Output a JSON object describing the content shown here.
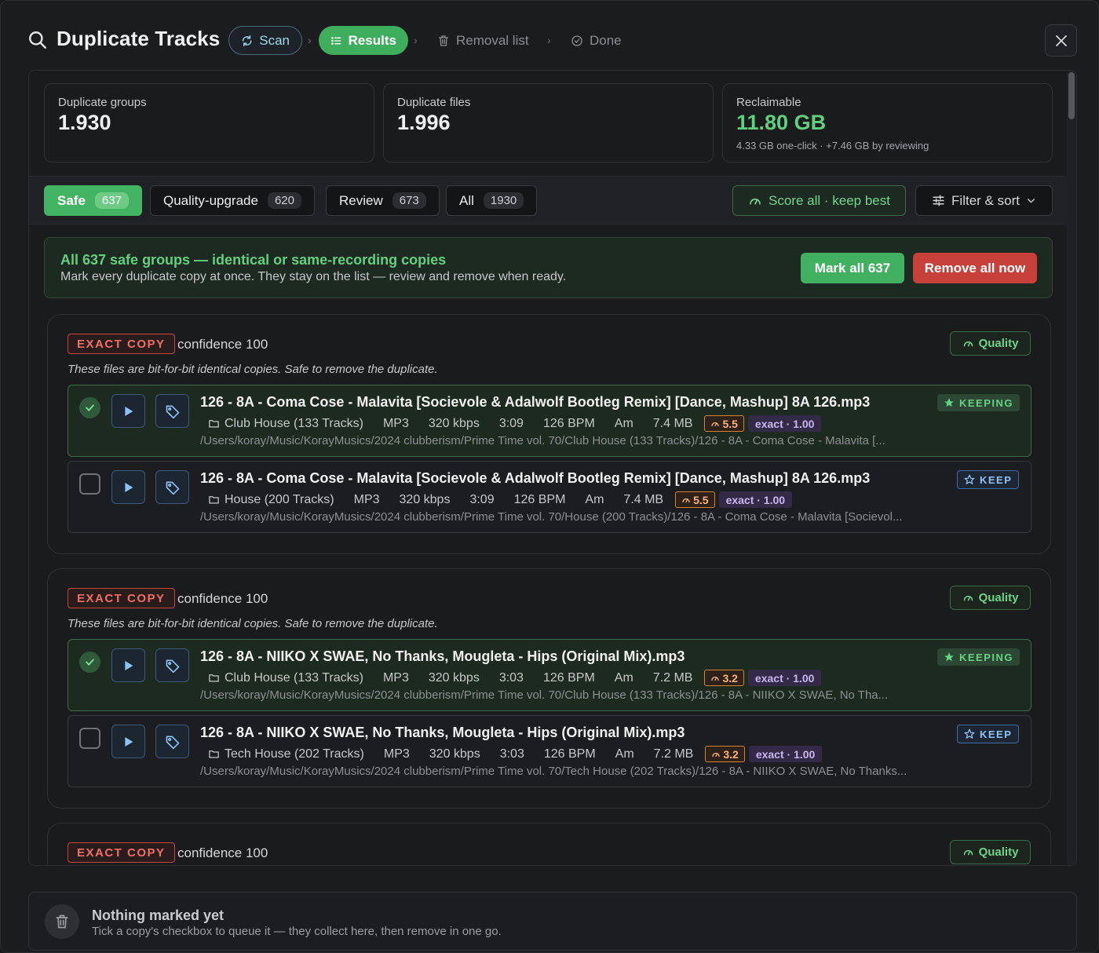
{
  "header": {
    "title": "Duplicate Tracks",
    "steps": {
      "scan": "Scan",
      "results": "Results",
      "removal": "Removal list",
      "done": "Done"
    }
  },
  "stats": {
    "groups": {
      "label": "Duplicate groups",
      "value": "1.930"
    },
    "files": {
      "label": "Duplicate files",
      "value": "1.996"
    },
    "reclaimable": {
      "label": "Reclaimable",
      "value": "11.80 GB",
      "sub": "4.33 GB one-click · +7.46 GB by reviewing"
    }
  },
  "tabs": [
    {
      "label": "Safe",
      "count": "637"
    },
    {
      "label": "Quality-upgrade",
      "count": "620"
    },
    {
      "label": "Review",
      "count": "673"
    },
    {
      "label": "All",
      "count": "1930"
    }
  ],
  "actions": {
    "score_all": "Score all · keep best",
    "filter_sort": "Filter & sort"
  },
  "banner": {
    "title": "All 637 safe groups — identical or same-recording copies",
    "subtitle": "Mark every duplicate copy at once. They stay on the list — review and remove when ready.",
    "mark_all": "Mark all 637",
    "remove_all": "Remove all now"
  },
  "groups": [
    {
      "badge": "EXACT COPY",
      "confidence": "confidence 100",
      "quality_label": "Quality",
      "description": "These files are bit-for-bit identical copies. Safe to remove the duplicate.",
      "tracks": [
        {
          "name": "126 - 8A - Coma Cose - Malavita [Socievole & Adalwolf Bootleg Remix] [Dance, Mashup] 8A 126.mp3",
          "folder": "Club House (133 Tracks)",
          "format": "MP3",
          "bitrate": "320 kbps",
          "duration": "3:09",
          "bpm": "126 BPM",
          "key": "Am",
          "size": "7.4 MB",
          "score": "5.5",
          "match": "exact · 1.00",
          "path": "/Users/koray/Music/KorayMusics/2024 clubberism/Prime Time vol. 70/Club House (133 Tracks)/126 - 8A - Coma Cose - Malavita [...",
          "status": "KEEPING"
        },
        {
          "name": "126 - 8A - Coma Cose - Malavita [Socievole & Adalwolf Bootleg Remix] [Dance, Mashup] 8A 126.mp3",
          "folder": "House (200 Tracks)",
          "format": "MP3",
          "bitrate": "320 kbps",
          "duration": "3:09",
          "bpm": "126 BPM",
          "key": "Am",
          "size": "7.4 MB",
          "score": "5.5",
          "match": "exact · 1.00",
          "path": "/Users/koray/Music/KorayMusics/2024 clubberism/Prime Time vol. 70/House (200 Tracks)/126 - 8A - Coma Cose - Malavita [Socievol...",
          "status": "KEEP"
        }
      ]
    },
    {
      "badge": "EXACT COPY",
      "confidence": "confidence 100",
      "quality_label": "Quality",
      "description": "These files are bit-for-bit identical copies. Safe to remove the duplicate.",
      "tracks": [
        {
          "name": "126 - 8A - NIIKO X SWAE, No Thanks, Mougleta - Hips (Original Mix).mp3",
          "folder": "Club House (133 Tracks)",
          "format": "MP3",
          "bitrate": "320 kbps",
          "duration": "3:03",
          "bpm": "126 BPM",
          "key": "Am",
          "size": "7.2 MB",
          "score": "3.2",
          "match": "exact · 1.00",
          "path": "/Users/koray/Music/KorayMusics/2024 clubberism/Prime Time vol. 70/Club House (133 Tracks)/126 - 8A - NIIKO X SWAE, No Tha...",
          "status": "KEEPING"
        },
        {
          "name": "126 - 8A - NIIKO X SWAE, No Thanks, Mougleta - Hips (Original Mix).mp3",
          "folder": "Tech House (202 Tracks)",
          "format": "MP3",
          "bitrate": "320 kbps",
          "duration": "3:03",
          "bpm": "126 BPM",
          "key": "Am",
          "size": "7.2 MB",
          "score": "3.2",
          "match": "exact · 1.00",
          "path": "/Users/koray/Music/KorayMusics/2024 clubberism/Prime Time vol. 70/Tech House (202 Tracks)/126 - 8A - NIIKO X SWAE, No Thanks...",
          "status": "KEEP"
        }
      ]
    },
    {
      "badge": "EXACT COPY",
      "confidence": "confidence 100",
      "quality_label": "Quality"
    }
  ],
  "footer": {
    "title": "Nothing marked yet",
    "subtitle": "Tick a copy's checkbox to queue it — they collect here, then remove in one go."
  },
  "icons": {
    "title": "search-icon",
    "scan": "refresh-icon",
    "results": "list-icon",
    "removal": "trash-icon",
    "done": "check-circle-icon",
    "close": "close-icon",
    "score": "gauge-icon",
    "filter": "sliders-icon",
    "play": "play-icon",
    "tag": "tag-icon",
    "folder": "folder-icon",
    "star": "star-icon"
  },
  "colors": {
    "accent_green": "#43b463",
    "danger_red": "#c7403a",
    "score_orange": "#d8802e",
    "keep_blue": "#3e6ba0"
  }
}
